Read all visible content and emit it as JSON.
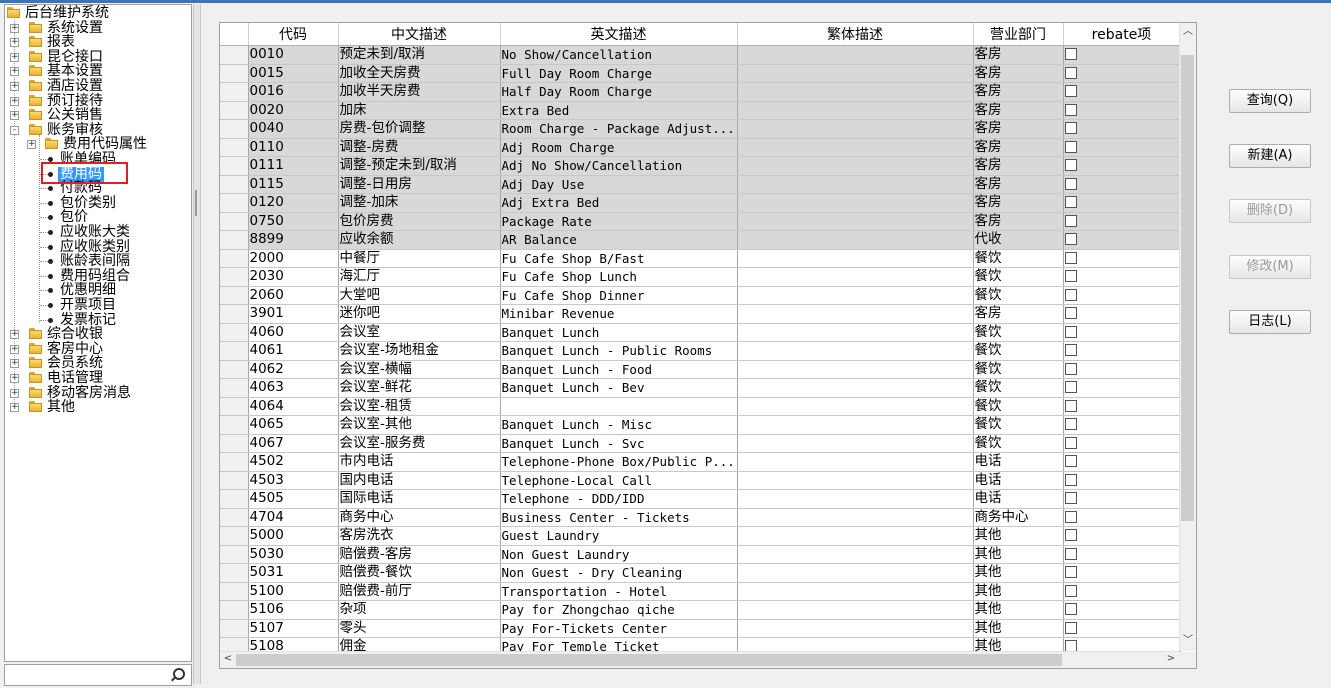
{
  "tree": {
    "items": [
      {
        "label": "后台维护系统",
        "level": 0,
        "kind": "folder",
        "expander": ""
      },
      {
        "label": "系统设置",
        "level": 1,
        "kind": "folder",
        "expander": "+"
      },
      {
        "label": "报表",
        "level": 1,
        "kind": "folder",
        "expander": "+"
      },
      {
        "label": "昆仑接口",
        "level": 1,
        "kind": "folder",
        "expander": "+"
      },
      {
        "label": "基本设置",
        "level": 1,
        "kind": "folder",
        "expander": "+"
      },
      {
        "label": "酒店设置",
        "level": 1,
        "kind": "folder",
        "expander": "+"
      },
      {
        "label": "预订接待",
        "level": 1,
        "kind": "folder",
        "expander": "+"
      },
      {
        "label": "公关销售",
        "level": 1,
        "kind": "folder",
        "expander": "+"
      },
      {
        "label": "账务审核",
        "level": 1,
        "kind": "folder",
        "expander": "-"
      },
      {
        "label": "费用代码属性",
        "level": 2,
        "kind": "folder",
        "expander": "+"
      },
      {
        "label": "账单编码",
        "level": 2,
        "kind": "leaf",
        "expander": ""
      },
      {
        "label": "费用码",
        "level": 2,
        "kind": "leaf",
        "expander": "",
        "selected": true
      },
      {
        "label": "付款码",
        "level": 2,
        "kind": "leaf",
        "expander": ""
      },
      {
        "label": "包价类别",
        "level": 2,
        "kind": "leaf",
        "expander": ""
      },
      {
        "label": "包价",
        "level": 2,
        "kind": "leaf",
        "expander": ""
      },
      {
        "label": "应收账大类",
        "level": 2,
        "kind": "leaf",
        "expander": ""
      },
      {
        "label": "应收账类别",
        "level": 2,
        "kind": "leaf",
        "expander": ""
      },
      {
        "label": "账龄表间隔",
        "level": 2,
        "kind": "leaf",
        "expander": ""
      },
      {
        "label": "费用码组合",
        "level": 2,
        "kind": "leaf",
        "expander": ""
      },
      {
        "label": "优惠明细",
        "level": 2,
        "kind": "leaf",
        "expander": ""
      },
      {
        "label": "开票项目",
        "level": 2,
        "kind": "leaf",
        "expander": ""
      },
      {
        "label": "发票标记",
        "level": 2,
        "kind": "leaf",
        "expander": ""
      },
      {
        "label": "综合收银",
        "level": 1,
        "kind": "folder",
        "expander": "+"
      },
      {
        "label": "客房中心",
        "level": 1,
        "kind": "folder",
        "expander": "+"
      },
      {
        "label": "会员系统",
        "level": 1,
        "kind": "folder",
        "expander": "+"
      },
      {
        "label": "电话管理",
        "level": 1,
        "kind": "folder",
        "expander": "+"
      },
      {
        "label": "移动客房消息",
        "level": 1,
        "kind": "folder",
        "expander": "+"
      },
      {
        "label": "其他",
        "level": 1,
        "kind": "folder",
        "expander": "+"
      }
    ]
  },
  "search": {
    "icon": "search-icon"
  },
  "grid": {
    "columns": [
      "代码",
      "中文描述",
      "英文描述",
      "繁体描述",
      "营业部门",
      "rebate项"
    ],
    "rows": [
      {
        "code": "0010",
        "cn": "预定未到/取消",
        "en": "No Show/Cancellation",
        "tw": "",
        "dept": "客房",
        "gray": true
      },
      {
        "code": "0015",
        "cn": "加收全天房费",
        "en": "Full Day Room Charge",
        "tw": "",
        "dept": "客房",
        "gray": true
      },
      {
        "code": "0016",
        "cn": "加收半天房费",
        "en": "Half Day Room Charge",
        "tw": "",
        "dept": "客房",
        "gray": true
      },
      {
        "code": "0020",
        "cn": "加床",
        "en": "Extra Bed",
        "tw": "",
        "dept": "客房",
        "gray": true
      },
      {
        "code": "0040",
        "cn": "房费-包价调整",
        "en": "Room Charge - Package Adjust...",
        "tw": "",
        "dept": "客房",
        "gray": true
      },
      {
        "code": "0110",
        "cn": "调整-房费",
        "en": "Adj Room Charge",
        "tw": "",
        "dept": "客房",
        "gray": true
      },
      {
        "code": "0111",
        "cn": "调整-预定未到/取消",
        "en": "Adj No Show/Cancellation",
        "tw": "",
        "dept": "客房",
        "gray": true
      },
      {
        "code": "0115",
        "cn": "调整-日用房",
        "en": "Adj Day Use",
        "tw": "",
        "dept": "客房",
        "gray": true
      },
      {
        "code": "0120",
        "cn": "调整-加床",
        "en": "Adj Extra Bed",
        "tw": "",
        "dept": "客房",
        "gray": true
      },
      {
        "code": "0750",
        "cn": "包价房费",
        "en": "Package Rate",
        "tw": "",
        "dept": "客房",
        "gray": true
      },
      {
        "code": "8899",
        "cn": "应收余额",
        "en": "AR Balance",
        "tw": "",
        "dept": "代收",
        "gray": true
      },
      {
        "code": "2000",
        "cn": "中餐厅",
        "en": "Fu Cafe Shop B/Fast",
        "tw": "",
        "dept": "餐饮",
        "gray": false
      },
      {
        "code": "2030",
        "cn": "海汇厅",
        "en": "Fu Cafe Shop Lunch",
        "tw": "",
        "dept": "餐饮",
        "gray": false
      },
      {
        "code": "2060",
        "cn": "大堂吧",
        "en": "Fu Cafe Shop Dinner",
        "tw": "",
        "dept": "餐饮",
        "gray": false
      },
      {
        "code": "3901",
        "cn": "迷你吧",
        "en": "Minibar Revenue",
        "tw": "",
        "dept": "客房",
        "gray": false
      },
      {
        "code": "4060",
        "cn": "会议室",
        "en": "Banquet Lunch",
        "tw": "",
        "dept": "餐饮",
        "gray": false
      },
      {
        "code": "4061",
        "cn": "会议室-场地租金",
        "en": "Banquet Lunch - Public Rooms",
        "tw": "",
        "dept": "餐饮",
        "gray": false
      },
      {
        "code": "4062",
        "cn": "会议室-横幅",
        "en": "Banquet Lunch - Food",
        "tw": "",
        "dept": "餐饮",
        "gray": false
      },
      {
        "code": "4063",
        "cn": "会议室-鲜花",
        "en": "Banquet Lunch - Bev",
        "tw": "",
        "dept": "餐饮",
        "gray": false
      },
      {
        "code": "4064",
        "cn": "会议室-租赁",
        "en": "",
        "tw": "",
        "dept": "餐饮",
        "gray": false
      },
      {
        "code": "4065",
        "cn": "会议室-其他",
        "en": "Banquet Lunch - Misc",
        "tw": "",
        "dept": "餐饮",
        "gray": false
      },
      {
        "code": "4067",
        "cn": "会议室-服务费",
        "en": "Banquet Lunch - Svc",
        "tw": "",
        "dept": "餐饮",
        "gray": false
      },
      {
        "code": "4502",
        "cn": "市内电话",
        "en": "Telephone-Phone Box/Public P...",
        "tw": "",
        "dept": "电话",
        "gray": false
      },
      {
        "code": "4503",
        "cn": "国内电话",
        "en": "Telephone-Local Call",
        "tw": "",
        "dept": "电话",
        "gray": false
      },
      {
        "code": "4505",
        "cn": "国际电话",
        "en": "Telephone - DDD/IDD",
        "tw": "",
        "dept": "电话",
        "gray": false
      },
      {
        "code": "4704",
        "cn": "商务中心",
        "en": "Business Center - Tickets",
        "tw": "",
        "dept": "商务中心",
        "gray": false
      },
      {
        "code": "5000",
        "cn": "客房洗衣",
        "en": "Guest Laundry",
        "tw": "",
        "dept": "其他",
        "gray": false
      },
      {
        "code": "5030",
        "cn": "赔偿费-客房",
        "en": "Non Guest Laundry",
        "tw": "",
        "dept": "其他",
        "gray": false
      },
      {
        "code": "5031",
        "cn": "赔偿费-餐饮",
        "en": "Non Guest - Dry Cleaning",
        "tw": "",
        "dept": "其他",
        "gray": false
      },
      {
        "code": "5100",
        "cn": "赔偿费-前厅",
        "en": "Transportation - Hotel",
        "tw": "",
        "dept": "其他",
        "gray": false
      },
      {
        "code": "5106",
        "cn": "杂项",
        "en": "Pay for Zhongchao qiche",
        "tw": "",
        "dept": "其他",
        "gray": false
      },
      {
        "code": "5107",
        "cn": "零头",
        "en": "Pay For-Tickets Center",
        "tw": "",
        "dept": "其他",
        "gray": false
      },
      {
        "code": "5108",
        "cn": "佣金",
        "en": "Pay For Temple Ticket",
        "tw": "",
        "dept": "其他",
        "gray": false
      }
    ]
  },
  "buttons": [
    {
      "label": "查询(Q)",
      "enabled": true,
      "name": "query-button"
    },
    {
      "label": "新建(A)",
      "enabled": true,
      "name": "new-button"
    },
    {
      "label": "删除(D)",
      "enabled": false,
      "name": "delete-button"
    },
    {
      "label": "修改(M)",
      "enabled": false,
      "name": "modify-button"
    },
    {
      "label": "日志(L)",
      "enabled": true,
      "name": "log-button"
    }
  ]
}
